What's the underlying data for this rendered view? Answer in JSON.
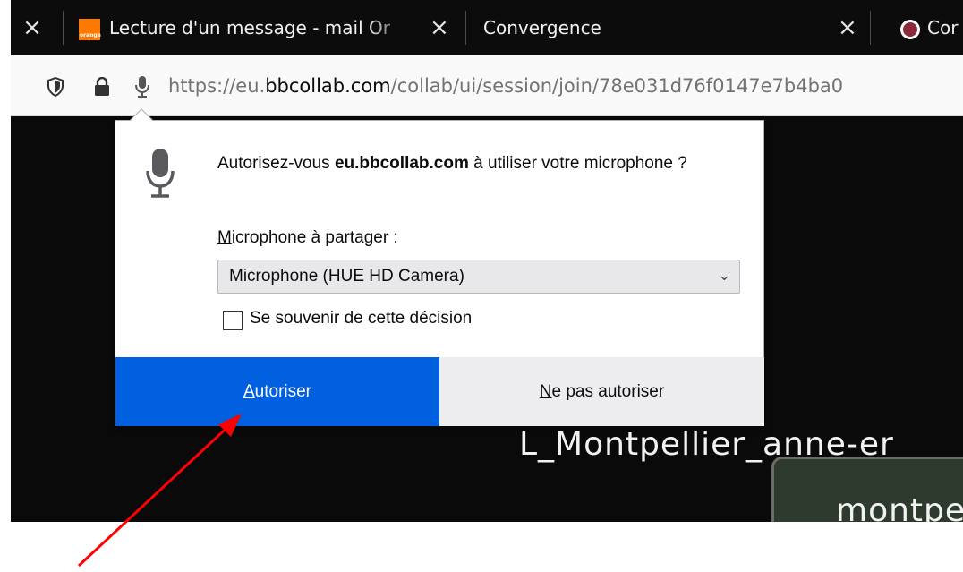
{
  "browser": {
    "tabs": [
      {
        "title": "Lecture d'un message - mail Or",
        "favicon_text": "orange",
        "favicon_color": "#ff7900"
      },
      {
        "title": "Convergence"
      },
      {
        "title": "Cor"
      }
    ],
    "url_prefix": "https://eu.",
    "url_domain": "bbcollab.com",
    "url_path": "/collab/ui/session/join/78e031d76f0147e7b4ba0",
    "icons": [
      "close-icon",
      "shield-icon",
      "lock-icon",
      "microphone-icon"
    ]
  },
  "permission_popup": {
    "message_prefix": "Autorisez-vous ",
    "message_domain": "eu.bbcollab.com",
    "message_suffix": " à utiliser votre microphone ?",
    "share_label": "Microphone à partager :",
    "selected_device": "Microphone (HUE HD Camera)",
    "remember_label": "Se souvenir de cette décision",
    "remember_checked": false,
    "allow_label": "Autoriser",
    "deny_label": "Ne pas autoriser",
    "allow_color": "#0060df"
  },
  "page": {
    "participant_label": "L_Montpellier_anne-er",
    "tile_label": "montpe"
  },
  "annotation": {
    "color": "#ff0000"
  }
}
